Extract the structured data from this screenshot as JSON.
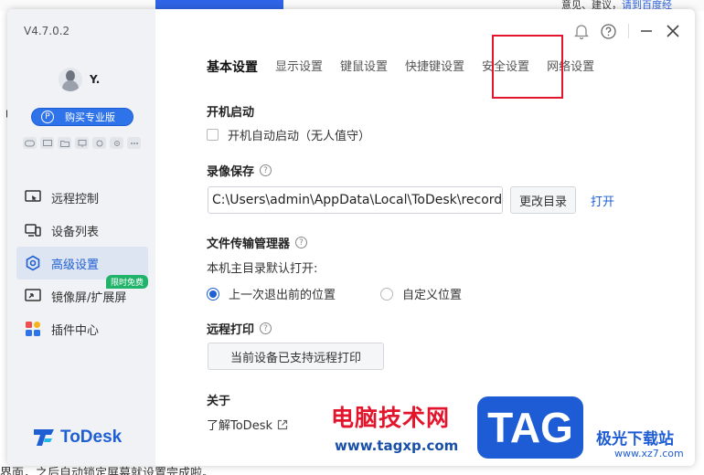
{
  "background": {
    "top_text_prefix": "意见、建议，",
    "top_text_link": "请到百度经",
    "left_char": "刂",
    "bottom_text": "界面，之后自动锁定屏幕就设置完成啦。"
  },
  "sidebar": {
    "version": "V4.7.0.2",
    "username": "Y.",
    "pro_badge": "P",
    "pro_button": "购买专业版",
    "nav": [
      {
        "label": "远程控制",
        "icon": "remote-control-icon"
      },
      {
        "label": "设备列表",
        "icon": "device-list-icon"
      },
      {
        "label": "高级设置",
        "icon": "advanced-settings-icon",
        "active": true
      },
      {
        "label": "镜像屏/扩展屏",
        "icon": "mirror-screen-icon",
        "tag": "限时免费"
      },
      {
        "label": "插件中心",
        "icon": "plugin-center-icon"
      }
    ],
    "logo_text": "ToDesk"
  },
  "tabs": [
    "基本设置",
    "显示设置",
    "键鼠设置",
    "快捷键设置",
    "安全设置",
    "网络设置"
  ],
  "active_tab": "基本设置",
  "highlighted_tab": "安全设置",
  "settings": {
    "startup": {
      "title": "开机启动",
      "checkbox_label": "开机自动启动（无人值守）",
      "checked": false
    },
    "recording": {
      "title": "录像保存",
      "path": "C:\\Users\\admin\\AppData\\Local\\ToDesk\\record",
      "change_button": "更改目录",
      "open_link": "打开"
    },
    "file_transfer": {
      "title": "文件传输管理器",
      "desc": "本机主目录默认打开:",
      "options": [
        "上一次退出前的位置",
        "自定义位置"
      ],
      "selected": 0
    },
    "remote_print": {
      "title": "远程打印",
      "button": "当前设备已支持远程打印"
    },
    "about": {
      "title": "关于",
      "link": "了解ToDesk"
    }
  },
  "watermark": {
    "cn": "电脑技术网",
    "url": "www.tagxp.com",
    "tag": "TAG",
    "site": "极光下载站",
    "site_url": "www.xz7.com"
  },
  "colors": {
    "accent": "#1f5fd3",
    "sidebar_bg": "#f0f2f5",
    "highlight": "#e3152d",
    "free_tag": "#22b36b"
  }
}
